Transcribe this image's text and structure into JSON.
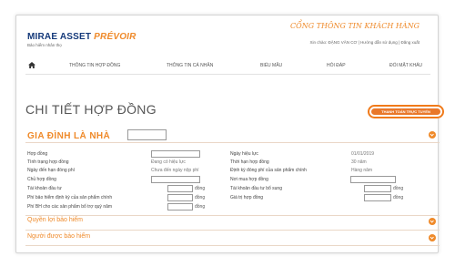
{
  "header": {
    "brand_main": "MIRAE ASSET",
    "brand_accent": "PRÉVOIR",
    "brand_tagline": "Bảo hiểm nhân thọ",
    "portal_title": "CỔNG THÔNG TIN KHÁCH HÀNG",
    "user_links": "Xin chào: ĐẶNG VĂN  CƠ | Hướng dẫn sử dụng | Đăng xuất"
  },
  "nav": {
    "items": [
      "THÔNG TIN HỢP ĐỒNG",
      "THÔNG TIN CÁ NHÂN",
      "BIỂU MẪU",
      "HỎI ĐÁP",
      "ĐỔI MẬT KHẨU"
    ]
  },
  "page": {
    "title": "CHI TIẾT HỢP ĐỒNG",
    "action_button": "THANH TOÁN TRỰC TUYẾN"
  },
  "section": {
    "title": "GIA ĐÌNH LÀ NHÀ",
    "title_input_value": ""
  },
  "fields": {
    "left": [
      {
        "label": "Hợp đồng",
        "value": ""
      },
      {
        "label": "Tình trạng hợp đồng",
        "value": "Đang có hiệu lực"
      },
      {
        "label": "Ngày đến hạn đóng phí",
        "value": "Chưa đến ngày nộp phí"
      },
      {
        "label": "Chủ hợp đồng",
        "value": ""
      },
      {
        "label": "Tài khoản đầu tư",
        "value": "",
        "unit": "đồng"
      },
      {
        "label": "Phí bảo hiểm định kỳ của sản phẩm chính",
        "value": "",
        "unit": "đồng"
      },
      {
        "label": "Phí BH cho các sản phẩm bổ trợ quý năm",
        "value": "",
        "unit": "đồng"
      }
    ],
    "right": [
      {
        "label": "Ngày hiệu lực",
        "value": "01/01/2019"
      },
      {
        "label": "Thời hạn hợp đồng",
        "value": "30 năm"
      },
      {
        "label": "Định kỳ đóng phí của sản phẩm chính",
        "value": "Hàng năm"
      },
      {
        "label": "Nơi mua hợp đồng",
        "value": ""
      },
      {
        "label": "Tài khoản đầu tư bổ sung",
        "value": "",
        "unit": "đồng"
      },
      {
        "label": "Giá trị hợp đồng",
        "value": "",
        "unit": "đồng"
      }
    ]
  },
  "subsections": [
    "Quyền lợi bảo hiểm",
    "Người được bảo hiểm"
  ],
  "colors": {
    "accent": "#ef8a2a",
    "brand_blue": "#14397a",
    "button_fill": "#e9782a"
  },
  "icons": [
    "home-icon",
    "chevron-down-icon"
  ]
}
